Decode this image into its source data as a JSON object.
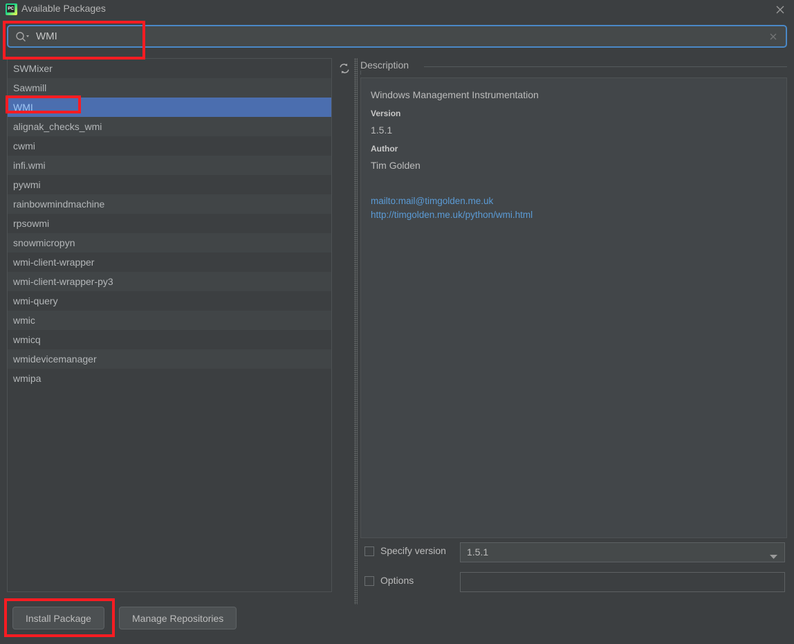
{
  "window": {
    "title": "Available Packages",
    "app_icon": "pycharm-logo",
    "app_icon_text": "PC",
    "close_icon": "close-icon"
  },
  "search": {
    "value": "WMI",
    "placeholder": "",
    "search_icon": "search-dropdown-icon",
    "clear_icon": "clear-icon"
  },
  "package_list": {
    "refresh_icon": "refresh-icon",
    "selected": "WMI",
    "items": [
      "SWMixer",
      "Sawmill",
      "WMI",
      "alignak_checks_wmi",
      "cwmi",
      "infi.wmi",
      "pywmi",
      "rainbowmindmachine",
      "rpsowmi",
      "snowmicropyn",
      "wmi-client-wrapper",
      "wmi-client-wrapper-py3",
      "wmi-query",
      "wmic",
      "wmicq",
      "wmidevicemanager",
      "wmipa"
    ]
  },
  "description": {
    "legend": "Description",
    "summary": "Windows Management Instrumentation",
    "version_label": "Version",
    "version_value": "1.5.1",
    "author_label": "Author",
    "author_value": "Tim Golden",
    "links": [
      "mailto:mail@timgolden.me.uk",
      "http://timgolden.me.uk/python/wmi.html"
    ]
  },
  "options": {
    "specify_version_label": "Specify version",
    "specify_version_checked": false,
    "version_selected": "1.5.1",
    "version_dropdown_icon": "chevron-down-icon",
    "options_label": "Options",
    "options_checked": false,
    "options_value": "",
    "options_placeholder": ""
  },
  "buttons": {
    "install": "Install Package",
    "manage": "Manage Repositories"
  },
  "annotations": {
    "color": "#fa1c22",
    "targets": [
      "search-field",
      "wmi-list-item",
      "install-package-button"
    ]
  }
}
